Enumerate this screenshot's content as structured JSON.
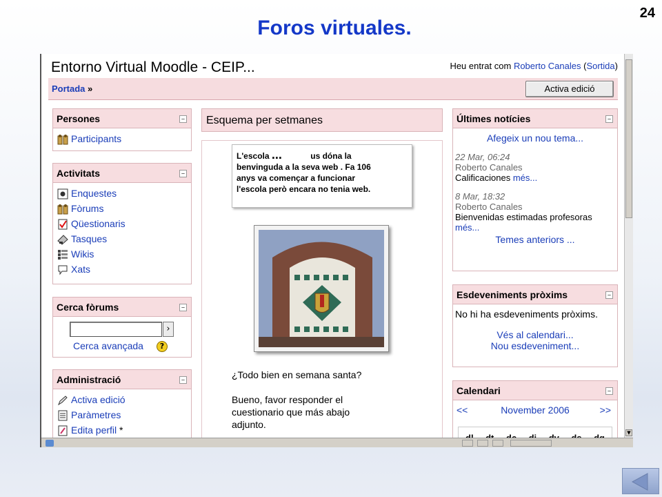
{
  "slide": {
    "title": "Foros virtuales.",
    "number": "24"
  },
  "moodle": {
    "site_title": "Entorno Virtual Moodle - CEIP...",
    "login": {
      "prefix": "Heu entrat com ",
      "user": "Roberto Canales",
      "open_paren": " (",
      "logout": "Sortida",
      "close_paren": ")"
    },
    "nav": {
      "home": "Portada",
      "separator": " »"
    },
    "edit_button": "Activa edició",
    "blocks": {
      "persones": {
        "title": "Persones",
        "items": [
          {
            "label": "Participants",
            "icon": "participants-icon"
          }
        ]
      },
      "activitats": {
        "title": "Activitats",
        "items": [
          {
            "label": "Enquestes",
            "icon": "survey-icon"
          },
          {
            "label": "Fòrums",
            "icon": "forum-icon"
          },
          {
            "label": "Qüestionaris",
            "icon": "quiz-icon"
          },
          {
            "label": "Tasques",
            "icon": "assignment-icon"
          },
          {
            "label": "Wikis",
            "icon": "wiki-icon"
          },
          {
            "label": "Xats",
            "icon": "chat-icon"
          }
        ]
      },
      "cerca": {
        "title": "Cerca fòrums",
        "search_button": "›",
        "advanced": "Cerca avançada",
        "help": "?"
      },
      "admin": {
        "title": "Administració",
        "items": [
          {
            "label": "Activa edició",
            "icon": "edit-icon"
          },
          {
            "label": "Paràmetres",
            "icon": "settings-icon"
          },
          {
            "label": "Edita perfil",
            "icon": "profile-icon",
            "suffix": " *"
          }
        ]
      },
      "news": {
        "title": "Últimes notícies",
        "add_topic": "Afegeix un nou tema...",
        "posts": [
          {
            "date": "22 Mar, 06:24",
            "author": "Roberto Canales",
            "text": "Calificaciones",
            "more": "més..."
          },
          {
            "date": "8 Mar, 18:32",
            "author": "Roberto Canales",
            "text": "Bienvenidas estimadas profesoras",
            "more": "més..."
          }
        ],
        "older": "Temes anteriors ..."
      },
      "events": {
        "title": "Esdeveniments pròxims",
        "empty": "No hi ha esdeveniments pròxims.",
        "goto_calendar": "Vés al calendari...",
        "new_event": "Nou esdeveniment..."
      },
      "calendar": {
        "title": "Calendari",
        "prev": "<<",
        "month": "November 2006",
        "next": ">>",
        "weekdays": [
          "dl",
          "dt",
          "dc",
          "di",
          "dv",
          "ds",
          "dg"
        ]
      }
    },
    "center": {
      "header": "Esquema per setmanes",
      "welcome": {
        "line1_a": "L'escola",
        "line1_dots": "...",
        "line1_b": "us dóna la",
        "line2": "benvinguda a la seva web . Fa 106",
        "line3": "anys va començar a funcionar",
        "line4": "l'escola però encara no tenia web."
      },
      "post": {
        "question": "¿Todo bien en semana santa?",
        "body1": "Bueno, favor responder el",
        "body2": "cuestionario que más abajo",
        "body3": "adjunto."
      }
    }
  }
}
